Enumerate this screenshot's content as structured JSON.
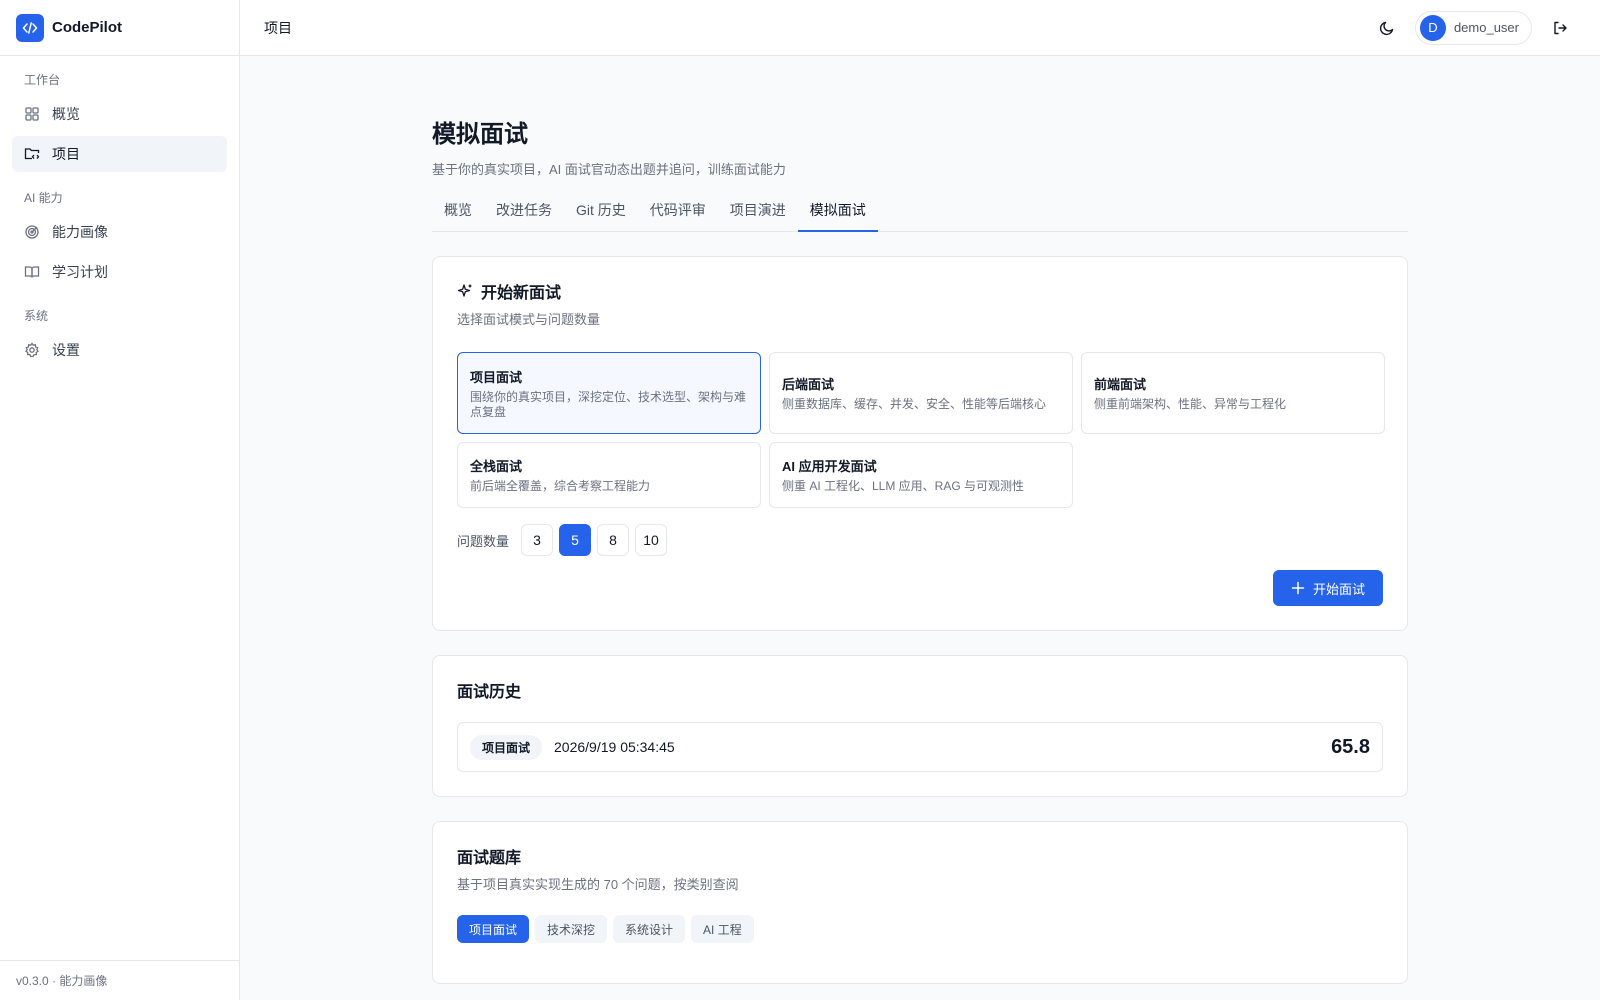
{
  "app": {
    "name": "CodePilot",
    "version_footer": "v0.3.0 · 能力画像",
    "colors": {
      "accent": "#2563eb",
      "border": "#e5e7eb",
      "muted": "#6b7280"
    }
  },
  "sidebar": {
    "groups": [
      {
        "title": "工作台",
        "items": [
          {
            "label": "概览",
            "icon": "dashboard-grid-icon",
            "active": false
          },
          {
            "label": "项目",
            "icon": "folder-code-icon",
            "active": true
          }
        ]
      },
      {
        "title": "AI 能力",
        "items": [
          {
            "label": "能力画像",
            "icon": "radar-target-icon",
            "active": false
          },
          {
            "label": "学习计划",
            "icon": "open-book-icon",
            "active": false
          }
        ]
      },
      {
        "title": "系统",
        "items": [
          {
            "label": "设置",
            "icon": "gear-icon",
            "active": false
          }
        ]
      }
    ]
  },
  "header": {
    "title": "项目",
    "user": {
      "initial": "D",
      "name": "demo_user"
    }
  },
  "page": {
    "title": "模拟面试",
    "subtitle": "基于你的真实项目，AI 面试官动态出题并追问，训练面试能力",
    "tabs": [
      "概览",
      "改进任务",
      "Git 历史",
      "代码评审",
      "项目演进",
      "模拟面试"
    ],
    "active_tab": 5
  },
  "new_interview": {
    "title": "开始新面试",
    "subtitle": "选择面试模式与问题数量",
    "modes": [
      {
        "title": "项目面试",
        "desc": "围绕你的真实项目，深挖定位、技术选型、架构与难点复盘",
        "selected": true
      },
      {
        "title": "后端面试",
        "desc": "侧重数据库、缓存、并发、安全、性能等后端核心",
        "selected": false
      },
      {
        "title": "前端面试",
        "desc": "侧重前端架构、性能、异常与工程化",
        "selected": false
      },
      {
        "title": "全栈面试",
        "desc": "前后端全覆盖，综合考察工程能力",
        "selected": false
      },
      {
        "title": "AI 应用开发面试",
        "desc": "侧重 AI 工程化、LLM 应用、RAG 与可观测性",
        "selected": false
      }
    ],
    "question_count_label": "问题数量",
    "question_counts": [
      "3",
      "5",
      "8",
      "10"
    ],
    "selected_count": "5",
    "start_button": "开始面试"
  },
  "history": {
    "title": "面试历史",
    "records": [
      {
        "mode": "项目面试",
        "time": "2026/9/19 05:34:45",
        "score": "65.8"
      }
    ]
  },
  "question_bank": {
    "title": "面试题库",
    "subtitle": "基于项目真实实现生成的 70 个问题，按类别查阅",
    "categories": [
      "项目面试",
      "技术深挖",
      "系统设计",
      "AI 工程"
    ],
    "active_category": 0
  }
}
